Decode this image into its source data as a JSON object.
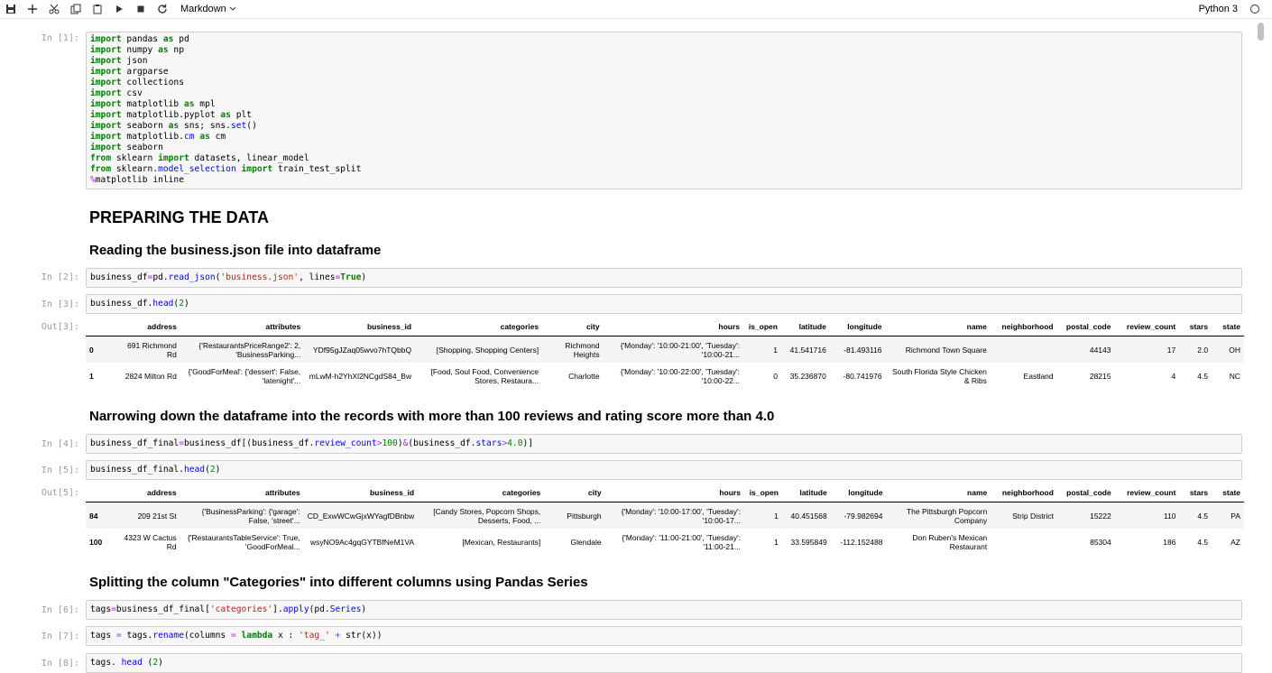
{
  "toolbar": {
    "cell_type": "Markdown",
    "kernel": "Python 3",
    "icons": [
      "save-icon",
      "add-icon",
      "cut-icon",
      "copy-icon",
      "paste-icon",
      "run-icon",
      "stop-icon",
      "restart-icon"
    ]
  },
  "cells": {
    "c1": {
      "prompt": "In [1]:"
    },
    "c2": {
      "prompt": "In [2]:"
    },
    "c3": {
      "prompt": "In [3]:"
    },
    "out3": {
      "prompt": "Out[3]:"
    },
    "c4": {
      "prompt": "In [4]:"
    },
    "c5": {
      "prompt": "In [5]:"
    },
    "out5": {
      "prompt": "Out[5]:"
    },
    "c6": {
      "prompt": "In [6]:"
    },
    "c7": {
      "prompt": "In [7]:"
    },
    "c8": {
      "prompt": "In [8]:"
    }
  },
  "headings": {
    "h1": "PREPARING THE DATA",
    "h2a": "Reading the business.json file into dataframe",
    "h2b": "Narrowing down the dataframe into the records with more than 100 reviews and rating score more than 4.0",
    "h2c": "Splitting the column \"Categories\" into different columns using Pandas Series"
  },
  "table_columns": [
    "address",
    "attributes",
    "business_id",
    "categories",
    "city",
    "hours",
    "is_open",
    "latitude",
    "longitude",
    "name",
    "neighborhood",
    "postal_code",
    "review_count",
    "stars",
    "state"
  ],
  "table1": [
    {
      "idx": "0",
      "address": "691 Richmond Rd",
      "attributes": "{'RestaurantsPriceRange2': 2, 'BusinessParking...",
      "business_id": "YDf95gJZaq05wvo7hTQbbQ",
      "categories": "[Shopping, Shopping Centers]",
      "city": "Richmond Heights",
      "hours": "{'Monday': '10:00-21:00', 'Tuesday': '10:00-21...",
      "is_open": "1",
      "latitude": "41.541716",
      "longitude": "-81.493116",
      "name": "Richmond Town Square",
      "neighborhood": "",
      "postal_code": "44143",
      "review_count": "17",
      "stars": "2.0",
      "state": "OH"
    },
    {
      "idx": "1",
      "address": "2824 Milton Rd",
      "attributes": "{'GoodForMeal': {'dessert': False, 'latenight'...",
      "business_id": "mLwM-h2YhXl2NCgdS84_Bw",
      "categories": "[Food, Soul Food, Convenience Stores, Restaura...",
      "city": "Charlotte",
      "hours": "{'Monday': '10:00-22:00', 'Tuesday': '10:00-22...",
      "is_open": "0",
      "latitude": "35.236870",
      "longitude": "-80.741976",
      "name": "South Florida Style Chicken & Ribs",
      "neighborhood": "Eastland",
      "postal_code": "28215",
      "review_count": "4",
      "stars": "4.5",
      "state": "NC"
    }
  ],
  "table2": [
    {
      "idx": "84",
      "address": "209 21st St",
      "attributes": "{'BusinessParking': {'garage': False, 'street'...",
      "business_id": "CD_ExwWCwGjxWYagfDBnbw",
      "categories": "[Candy Stores, Popcorn Shops, Desserts, Food, ...",
      "city": "Pittsburgh",
      "hours": "{'Monday': '10:00-17:00', 'Tuesday': '10:00-17...",
      "is_open": "1",
      "latitude": "40.451568",
      "longitude": "-79.982694",
      "name": "The Pittsburgh Popcorn Company",
      "neighborhood": "Strip District",
      "postal_code": "15222",
      "review_count": "110",
      "stars": "4.5",
      "state": "PA"
    },
    {
      "idx": "100",
      "address": "4323 W Cactus Rd",
      "attributes": "{'RestaurantsTableService': True, 'GoodForMeal...",
      "business_id": "wsyNO9Ac4gqGYTBfNeM1VA",
      "categories": "[Mexican, Restaurants]",
      "city": "Glendale",
      "hours": "{'Monday': '11:00-21:00', 'Tuesday': '11:00-21...",
      "is_open": "1",
      "latitude": "33.595849",
      "longitude": "-112.152488",
      "name": "Don Ruben's Mexican Restaurant",
      "neighborhood": "",
      "postal_code": "85304",
      "review_count": "186",
      "stars": "4.5",
      "state": "AZ"
    }
  ]
}
